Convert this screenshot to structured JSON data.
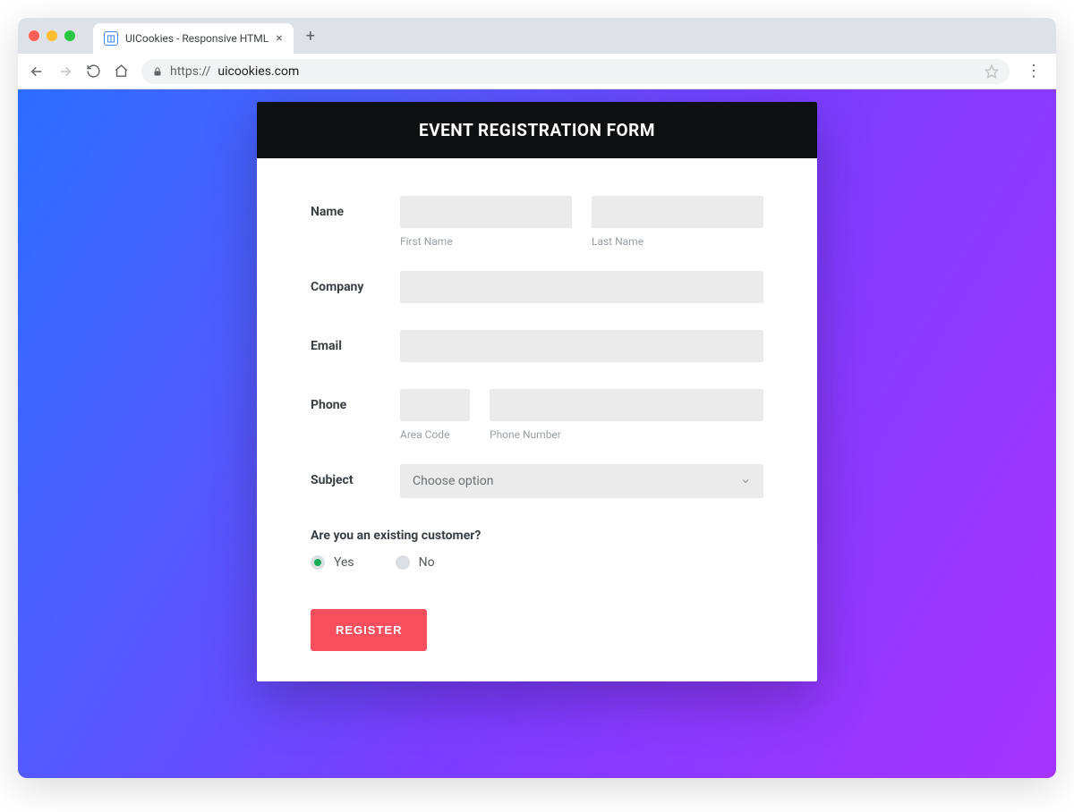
{
  "browser": {
    "tab_title": "UICookies - Responsive HTML",
    "url_scheme": "https://",
    "url_host": "uicookies.com"
  },
  "form": {
    "title": "EVENT REGISTRATION FORM",
    "name": {
      "label": "Name",
      "first_sub": "First Name",
      "last_sub": "Last Name"
    },
    "company": {
      "label": "Company"
    },
    "email": {
      "label": "Email"
    },
    "phone": {
      "label": "Phone",
      "area_sub": "Area Code",
      "number_sub": "Phone Number"
    },
    "subject": {
      "label": "Subject",
      "placeholder": "Choose option"
    },
    "existing": {
      "question": "Are you an existing customer?",
      "yes": "Yes",
      "no": "No",
      "selected": "yes"
    },
    "submit": "REGISTER"
  }
}
